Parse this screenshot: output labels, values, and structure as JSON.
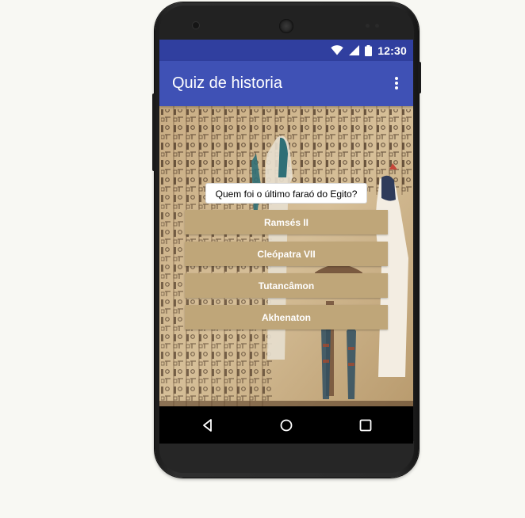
{
  "status_bar": {
    "time": "12:30",
    "icons": [
      "wifi-icon",
      "cell-signal-icon",
      "battery-icon"
    ]
  },
  "app_bar": {
    "title": "Quiz de historia",
    "menu_icon": "overflow-menu-icon"
  },
  "quiz": {
    "question": "Quem foi o último faraó do Egito?",
    "answers": [
      "Ramsés II",
      "Cleópatra VII",
      "Tutancâmon",
      "Akhenaton"
    ]
  },
  "nav_bar": {
    "icons": [
      "back-icon",
      "home-icon",
      "recents-icon"
    ]
  },
  "colors": {
    "status_bar": "#303f9f",
    "app_bar": "#3f51b5",
    "answer_button": "#bfa679",
    "background": "#cdb48b"
  }
}
